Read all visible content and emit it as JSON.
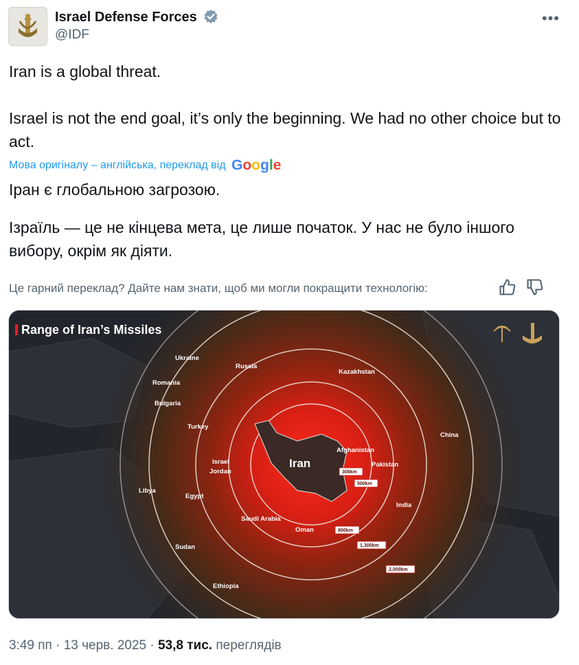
{
  "author": {
    "name": "Israel Defense Forces",
    "handle": "@IDF",
    "verified_icon": "verified-badge-icon"
  },
  "menu_icon": "more-options-icon",
  "tweet": {
    "line1": "Iran is a global threat.",
    "line2": "Israel is not the end goal, it’s only the beginning. We had no other choice but to act."
  },
  "translation": {
    "note": "Мова оригіналу – англійська, переклад від",
    "provider": "Google",
    "line1": "Іран є глобальною загрозою.",
    "line2": "Ізраїль — це не кінцева мета, це лише початок. У нас не було іншого вибору, окрім як діяти."
  },
  "feedback": {
    "prompt": "Це гарний переклад? Дайте нам знати, щоб ми могли покращити технологію:",
    "thumbs_up_icon": "thumbs-up-icon",
    "thumbs_down_icon": "thumbs-down-icon"
  },
  "map": {
    "title": "Range of Iran’s Missiles",
    "center_label": "Iran",
    "ranges": [
      "300km",
      "500km",
      "800km",
      "1,300km",
      "2,000km"
    ],
    "countries": [
      "Ukraine",
      "Russia",
      "Kazakhstan",
      "Romania",
      "Bulgaria",
      "Turkey",
      "China",
      "Afghanistan",
      "Pakistan",
      "Israel",
      "Jordan",
      "Libya",
      "Egypt",
      "India",
      "Saudi Arabia",
      "Oman",
      "Sudan",
      "Ethiopia"
    ],
    "colors": {
      "core": "#e81e1e",
      "mid": "#8b1a0c",
      "outer": "#3b2a1c",
      "land": "#2b2e34",
      "sea": "#1c1f24"
    }
  },
  "footer": {
    "time": "3:49 пп · 13 черв. 2025 ·",
    "views_count": "53,8 тис.",
    "views_label": "переглядів"
  }
}
